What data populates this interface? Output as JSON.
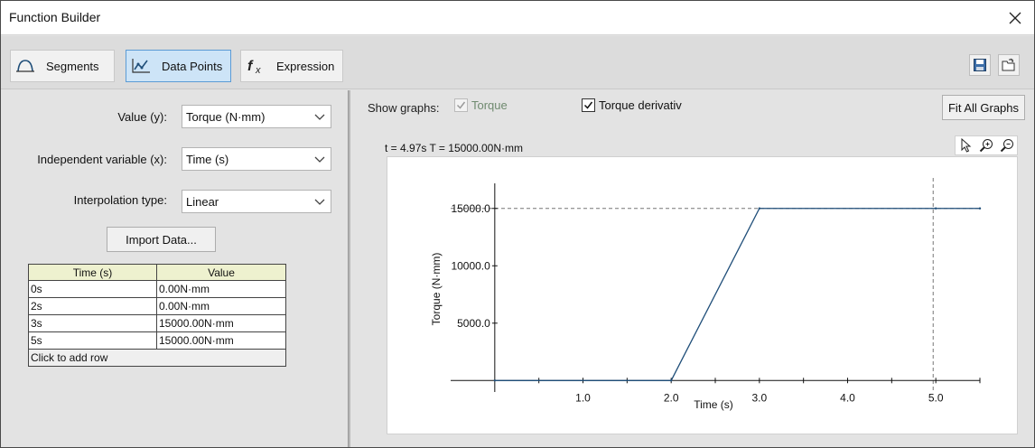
{
  "window": {
    "title": "Function Builder"
  },
  "tabs": [
    {
      "label": "Segments",
      "icon": "segments-icon",
      "active": false
    },
    {
      "label": "Data Points",
      "icon": "data-points-icon",
      "active": true
    },
    {
      "label": "Expression",
      "icon": "fx-icon",
      "active": false
    }
  ],
  "form": {
    "value_label": "Value (y):",
    "value_selected": "Torque (N·mm)",
    "indep_label": "Independent variable (x):",
    "indep_selected": "Time (s)",
    "interp_label": "Interpolation type:",
    "interp_selected": "Linear",
    "import_button": "Import Data..."
  },
  "table": {
    "headers": [
      "Time (s)",
      "Value"
    ],
    "rows": [
      [
        "0s",
        "0.00N·mm"
      ],
      [
        "2s",
        "0.00N·mm"
      ],
      [
        "3s",
        "15000.00N·mm"
      ],
      [
        "5s",
        "15000.00N·mm"
      ]
    ],
    "add_row": "Click to add row"
  },
  "graph_options": {
    "show_label": "Show graphs:",
    "torque_label": "Torque",
    "torque_checked": true,
    "torque_disabled": true,
    "deriv_label": "Torque derivativ",
    "deriv_checked": true,
    "fit_button": "Fit All Graphs"
  },
  "readout": "t = 4.97s  T = 15000.00N·mm",
  "colors": {
    "line": "#1f4e79",
    "active_tab": "#cde4f7",
    "table_header": "#eef1cf"
  },
  "chart_data": {
    "type": "line",
    "x": [
      0,
      2,
      3,
      5,
      5.5
    ],
    "series": [
      {
        "values": [
          0,
          0,
          15000,
          15000,
          15000
        ]
      }
    ],
    "xlabel": "Time (s)",
    "ylabel": "Torque (N·mm)",
    "xticks": [
      "1.0",
      "2.0",
      "3.0",
      "4.0",
      "5.0"
    ],
    "yticks": [
      "5000.0",
      "10000.0",
      "15000.0"
    ],
    "xlim": [
      -0.5,
      5.5
    ],
    "ylim": [
      -1000,
      17500
    ],
    "cursor": {
      "x": 4.97,
      "y": 15000
    }
  }
}
